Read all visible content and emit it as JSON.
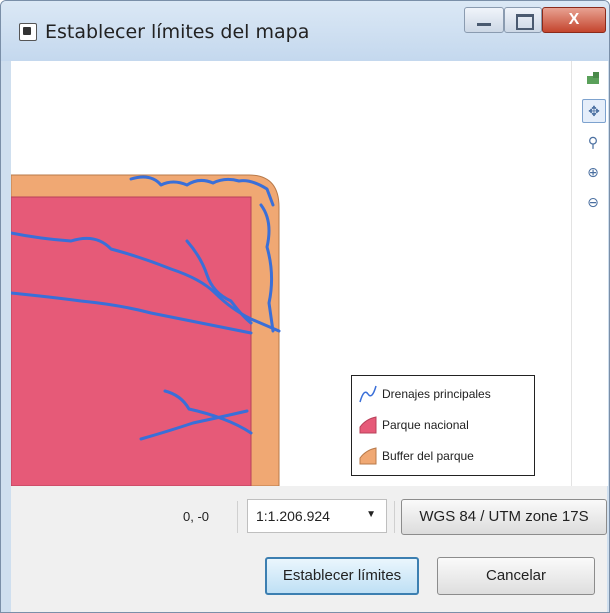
{
  "window": {
    "title": "Establecer límites del mapa",
    "close_label": "X"
  },
  "toolbar": {
    "tools": [
      {
        "icon": "full-extent-icon"
      },
      {
        "icon": "pan-icon",
        "active": true
      },
      {
        "icon": "zoom-box-icon"
      },
      {
        "icon": "zoom-in-icon"
      },
      {
        "icon": "zoom-out-icon"
      }
    ]
  },
  "map": {
    "colors": {
      "parque": "#e65a78",
      "buffer": "#f0a873",
      "drenajes": "#3a6fd8"
    }
  },
  "legend": {
    "items": [
      {
        "label": "Drenajes principales",
        "icon": "line-symbol-icon"
      },
      {
        "label": "Parque nacional",
        "icon": "polygon-pink-icon"
      },
      {
        "label": "Buffer del parque",
        "icon": "polygon-orange-icon"
      }
    ]
  },
  "statusbar": {
    "coords": "0, -0",
    "scale": "1:1.206.924",
    "crs": "WGS 84 / UTM zone 17S"
  },
  "buttons": {
    "set_limits": "Establecer límites",
    "cancel": "Cancelar"
  }
}
